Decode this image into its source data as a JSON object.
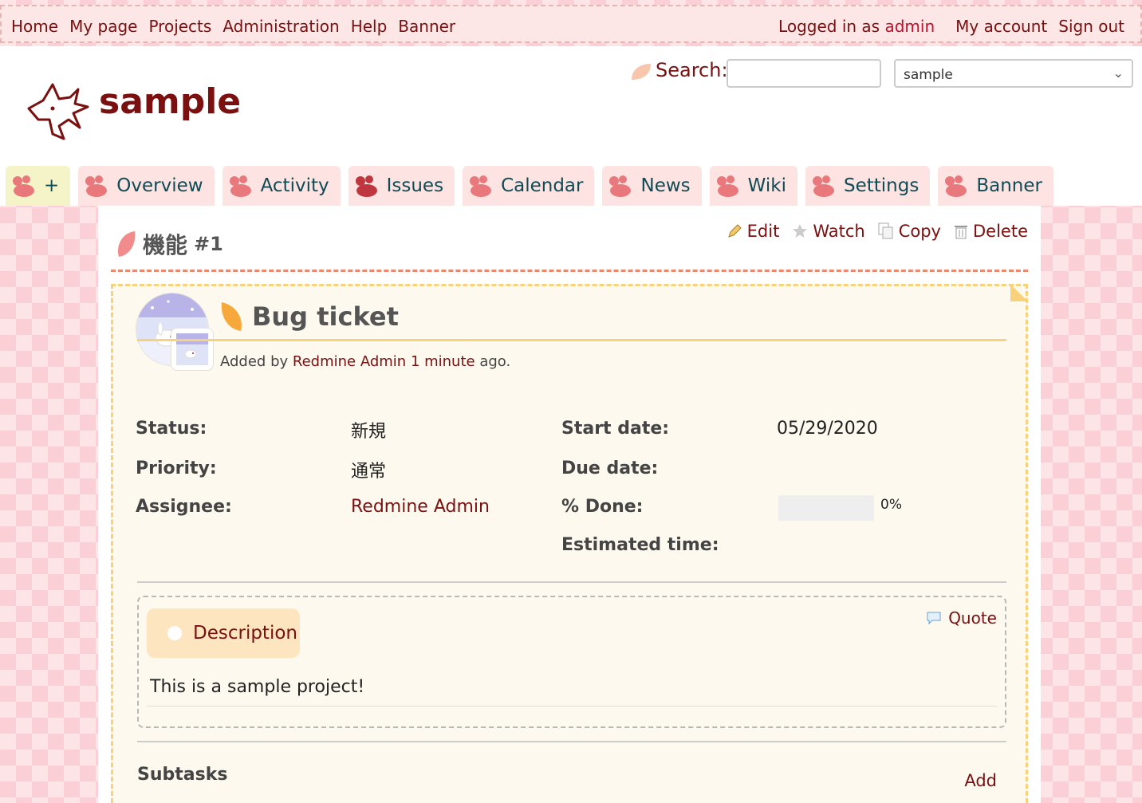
{
  "top_menu": {
    "items": [
      "Home",
      "My page",
      "Projects",
      "Administration",
      "Help",
      "Banner"
    ],
    "logged_in_prefix": "Logged in as",
    "logged_in_user": "admin",
    "my_account": "My account",
    "sign_out": "Sign out"
  },
  "header": {
    "project_title": "sample",
    "search_label": "Search:",
    "search_value": "",
    "project_jump": "sample"
  },
  "tabs": [
    {
      "label": "+",
      "icon": "paw-icon"
    },
    {
      "label": "Overview",
      "icon": "paw-icon"
    },
    {
      "label": "Activity",
      "icon": "paw-icon"
    },
    {
      "label": "Issues",
      "icon": "paw-icon",
      "selected": true
    },
    {
      "label": "Calendar",
      "icon": "paw-icon"
    },
    {
      "label": "News",
      "icon": "paw-icon"
    },
    {
      "label": "Wiki",
      "icon": "paw-icon"
    },
    {
      "label": "Settings",
      "icon": "paw-icon"
    },
    {
      "label": "Banner",
      "icon": "paw-icon"
    }
  ],
  "issue": {
    "tracker": "機能",
    "number": "#1",
    "actions": {
      "edit": "Edit",
      "watch": "Watch",
      "copy": "Copy",
      "delete": "Delete"
    },
    "subject": "Bug ticket",
    "author_prefix": "Added by",
    "author": "Redmine Admin",
    "age": "1 minute",
    "age_suffix": "ago.",
    "attributes": {
      "status_label": "Status:",
      "status": "新規",
      "priority_label": "Priority:",
      "priority": "通常",
      "assignee_label": "Assignee:",
      "assignee": "Redmine Admin",
      "start_date_label": "Start date:",
      "start_date": "05/29/2020",
      "due_date_label": "Due date:",
      "due_date": "",
      "done_label": "% Done:",
      "done_percent": "0%",
      "done_fraction": 0,
      "estimated_label": "Estimated time:",
      "estimated": ""
    },
    "description_title": "Description",
    "quote": "Quote",
    "description": "This is a sample project!",
    "subtasks_label": "Subtasks",
    "add_label": "Add"
  },
  "colors": {
    "accent": "#7a1010",
    "tab_text": "#0f4b55",
    "yellow_border": "#f8d27a"
  }
}
